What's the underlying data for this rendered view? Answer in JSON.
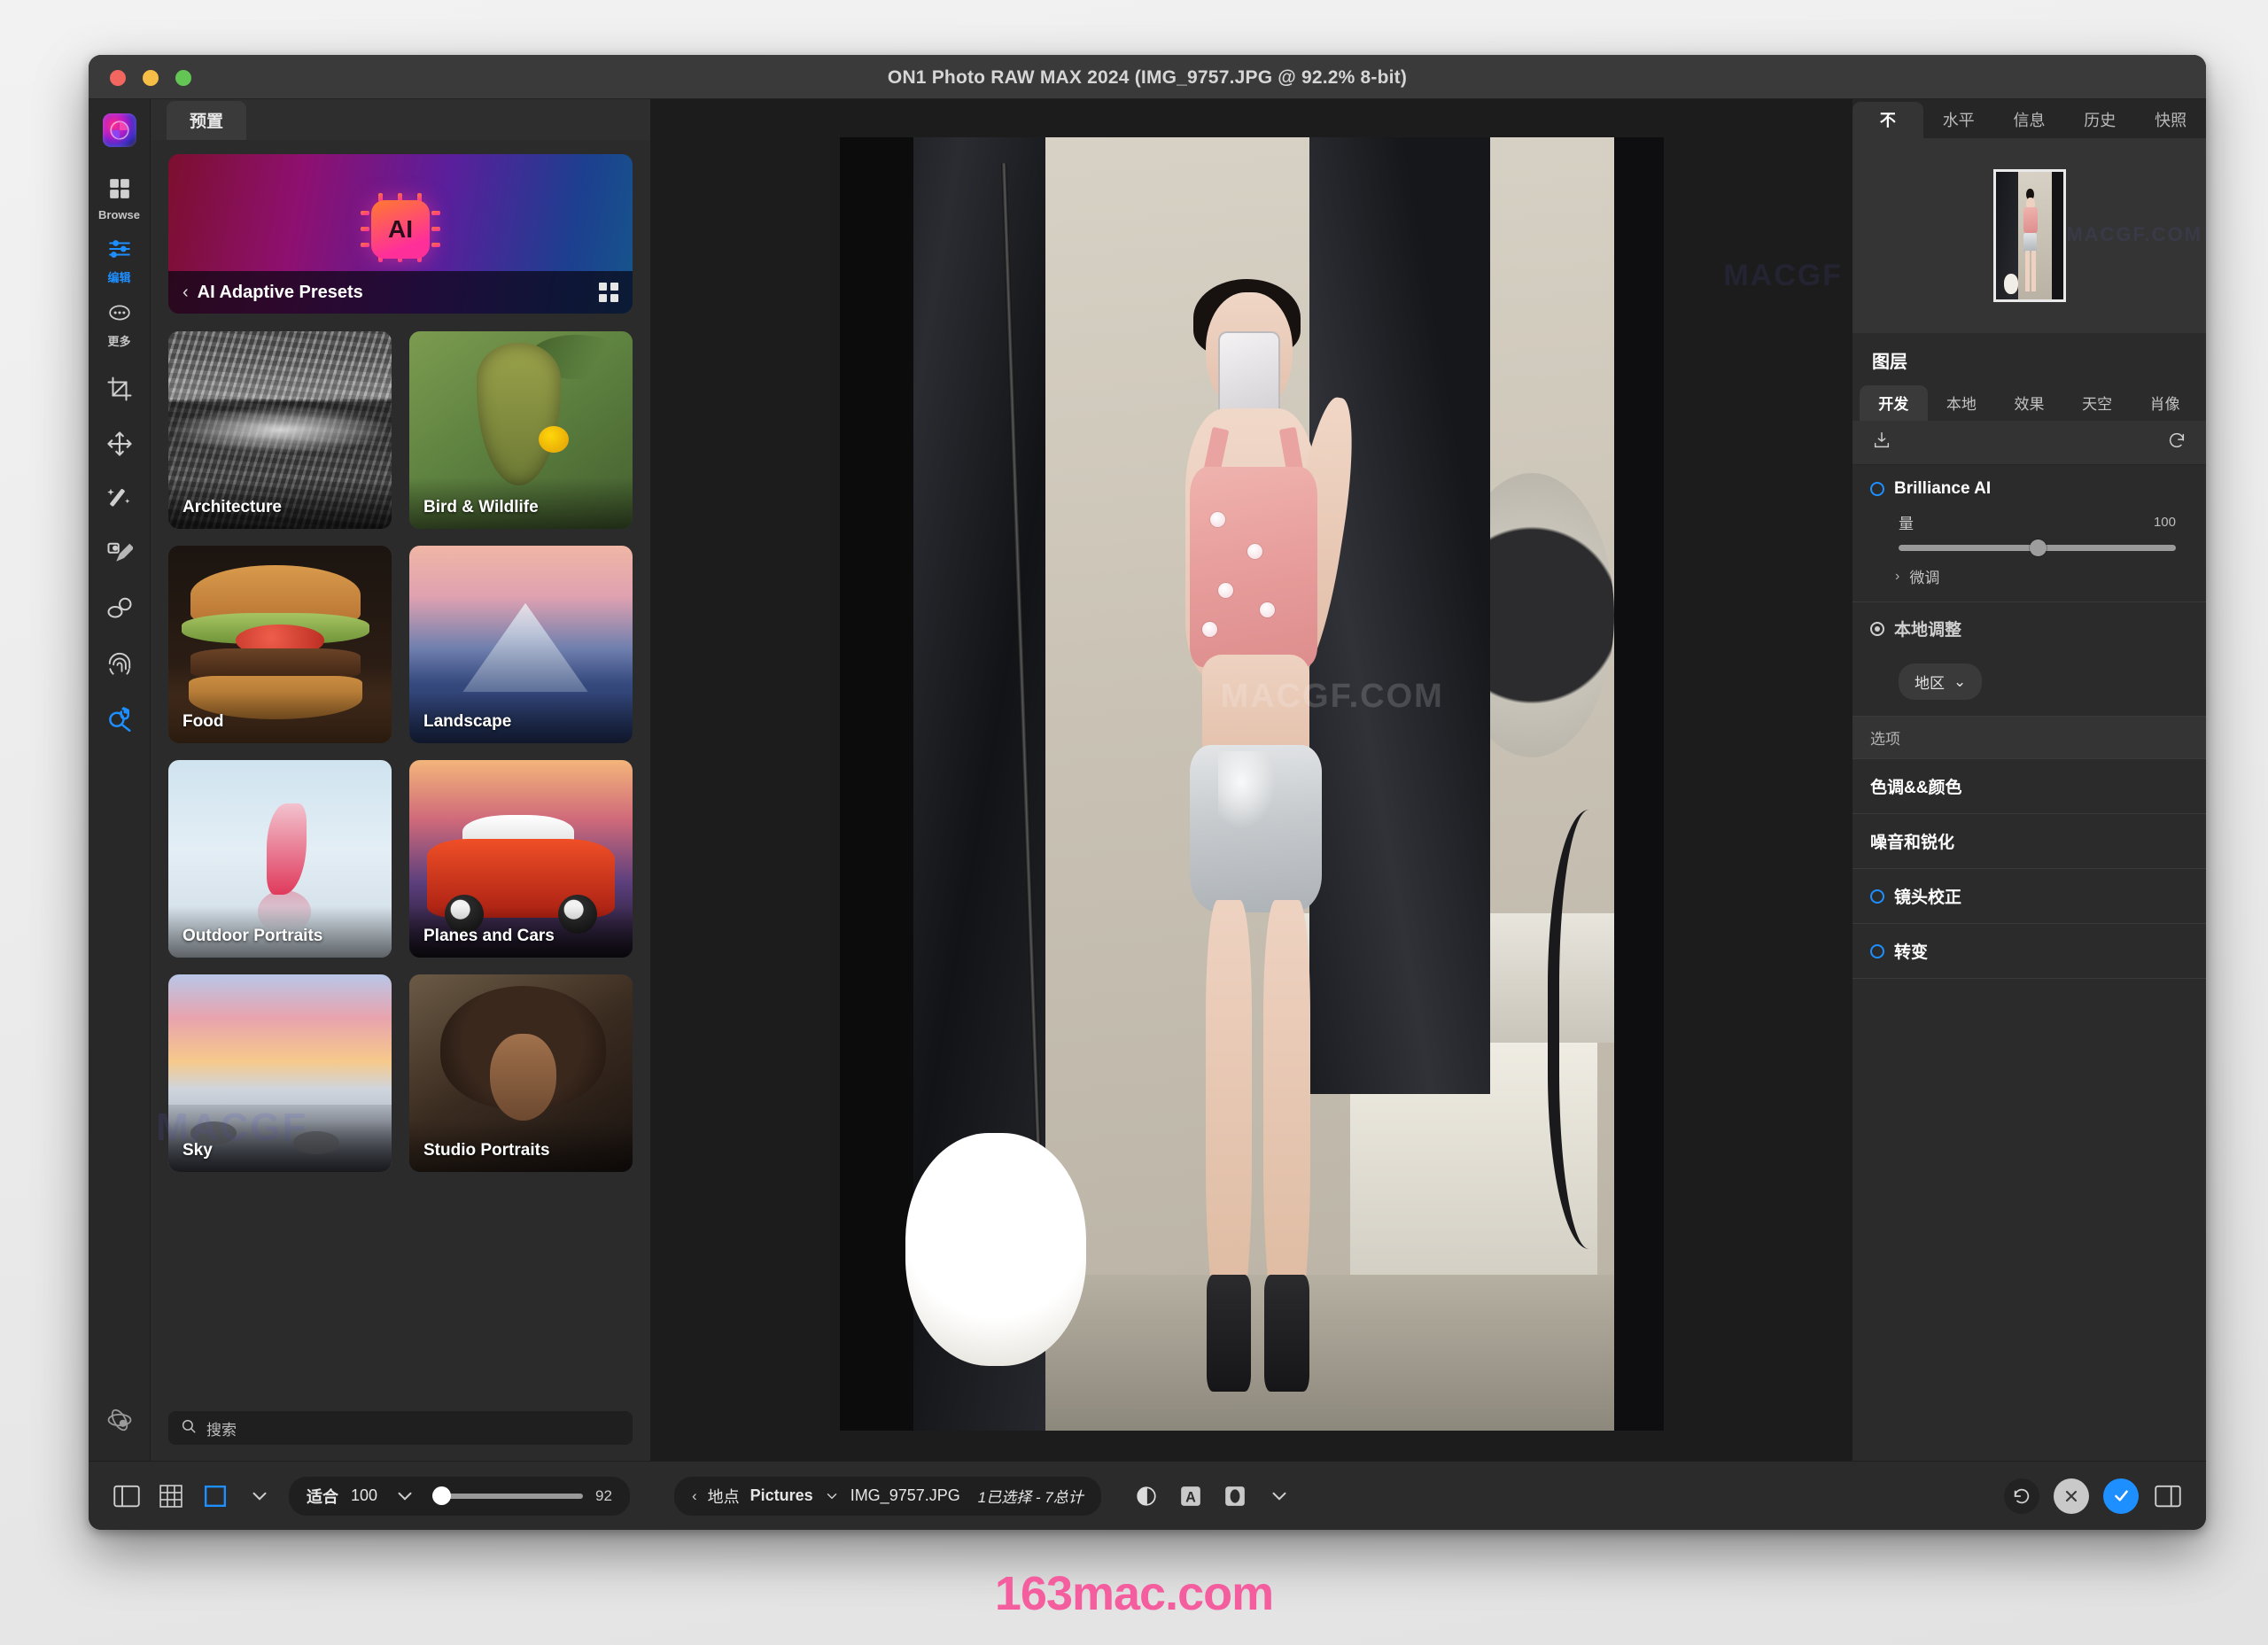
{
  "window": {
    "title": "ON1 Photo RAW MAX 2024 (IMG_9757.JPG @ 92.2% 8-bit)",
    "traffic_lights": [
      "close",
      "minimize",
      "zoom"
    ]
  },
  "rail": {
    "logo": "on1-logo-icon",
    "modes": [
      {
        "id": "browse",
        "label": "Browse",
        "icon": "grid-icon",
        "active": false
      },
      {
        "id": "edit",
        "label": "编辑",
        "icon": "sliders-icon",
        "active": true
      },
      {
        "id": "more",
        "label": "更多",
        "icon": "ellipsis-icon",
        "active": false
      }
    ],
    "tools": [
      {
        "id": "crop",
        "icon": "crop-icon"
      },
      {
        "id": "transform",
        "icon": "move-icon"
      },
      {
        "id": "retouch",
        "icon": "magic-wand-icon"
      },
      {
        "id": "brush",
        "icon": "paint-brush-icon"
      },
      {
        "id": "blemish",
        "icon": "blemish-remover-icon"
      },
      {
        "id": "clone",
        "icon": "fingerprint-icon"
      },
      {
        "id": "zoom-pan",
        "icon": "zoom-hand-icon"
      }
    ],
    "bottom": {
      "id": "soft-proof",
      "icon": "atom-icon"
    }
  },
  "presets": {
    "tab_label": "预置",
    "banner": {
      "title": "AI Adaptive Presets",
      "back_icon": "chevron-left-icon",
      "grid_icon": "grid-view-icon",
      "chip_text": "AI"
    },
    "items": [
      {
        "label": "Architecture",
        "art": "arch"
      },
      {
        "label": "Bird & Wildlife",
        "art": "bird"
      },
      {
        "label": "Food",
        "art": "food"
      },
      {
        "label": "Landscape",
        "art": "land"
      },
      {
        "label": "Outdoor Portraits",
        "art": "outdoor"
      },
      {
        "label": "Planes and Cars",
        "art": "planes"
      },
      {
        "label": "Sky",
        "art": "sky"
      },
      {
        "label": "Studio Portraits",
        "art": "studio"
      }
    ],
    "search": {
      "placeholder": "搜索",
      "value": "",
      "icon": "search-icon"
    }
  },
  "canvas": {
    "watermarks": [
      "MACGF.COM",
      "MACGF.COM",
      "MACGF"
    ]
  },
  "right_panel": {
    "tabs": [
      {
        "label": "不",
        "active": true
      },
      {
        "label": "水平",
        "active": false
      },
      {
        "label": "信息",
        "active": false
      },
      {
        "label": "历史",
        "active": false
      },
      {
        "label": "快照",
        "active": false
      }
    ],
    "layers_title": "图层",
    "module_tabs": [
      {
        "label": "开发",
        "active": true
      },
      {
        "label": "本地",
        "active": false
      },
      {
        "label": "效果",
        "active": false
      },
      {
        "label": "天空",
        "active": false
      },
      {
        "label": "肖像",
        "active": false
      }
    ],
    "tool_row": {
      "left_icon": "import-preset-icon",
      "right_icon": "reset-icon"
    },
    "brilliance": {
      "title": "Brilliance AI",
      "enabled_icon": "radio-outline-icon",
      "slider": {
        "label": "量",
        "value": 100,
        "min": 0,
        "max": 200,
        "percent": 50
      },
      "subsection": {
        "label": "微调",
        "icon": "chevron-right-icon"
      }
    },
    "local_adjust": {
      "title": "本地调整",
      "icon": "radio-filled-icon",
      "dropdown": {
        "label": "地区",
        "icon": "chevron-down-icon"
      }
    },
    "options_header": "选项",
    "options": [
      {
        "label": "色调&&颜色",
        "has_toggle": false
      },
      {
        "label": "噪音和锐化",
        "has_toggle": false
      },
      {
        "label": "镜头校正",
        "has_toggle": true
      },
      {
        "label": "转变",
        "has_toggle": true
      }
    ]
  },
  "bottombar": {
    "left_icons": [
      "panel-toggle-icon",
      "grid-view-icon",
      "single-view-icon",
      "chevron-down-icon"
    ],
    "zoom": {
      "fit_label": "适合",
      "level": "100",
      "chevron": "chevron-down-icon",
      "value": "92"
    },
    "breadcrumb": {
      "back_icon": "chevron-left-icon",
      "location_label": "地点",
      "folder": "Pictures",
      "folder_chevron": "chevron-down-icon",
      "filename": "IMG_9757.JPG",
      "selection": "1已选择 - 7总计"
    },
    "view_icons": [
      "preview-eye-icon",
      "text-overlay-icon",
      "mask-icon",
      "chevron-down-icon"
    ],
    "actions": [
      {
        "id": "reset",
        "icon": "undo-icon"
      },
      {
        "id": "cancel",
        "icon": "close-icon"
      },
      {
        "id": "apply",
        "icon": "check-icon"
      },
      {
        "id": "right-panel-toggle",
        "icon": "panel-toggle-right-icon"
      }
    ]
  },
  "page_watermark": "163mac.com",
  "colors": {
    "accent": "#1e8fff",
    "window_bg": "#2b2b2b",
    "titlebar": "#3a3a3a",
    "watermark_pink": "#f45e9e"
  }
}
